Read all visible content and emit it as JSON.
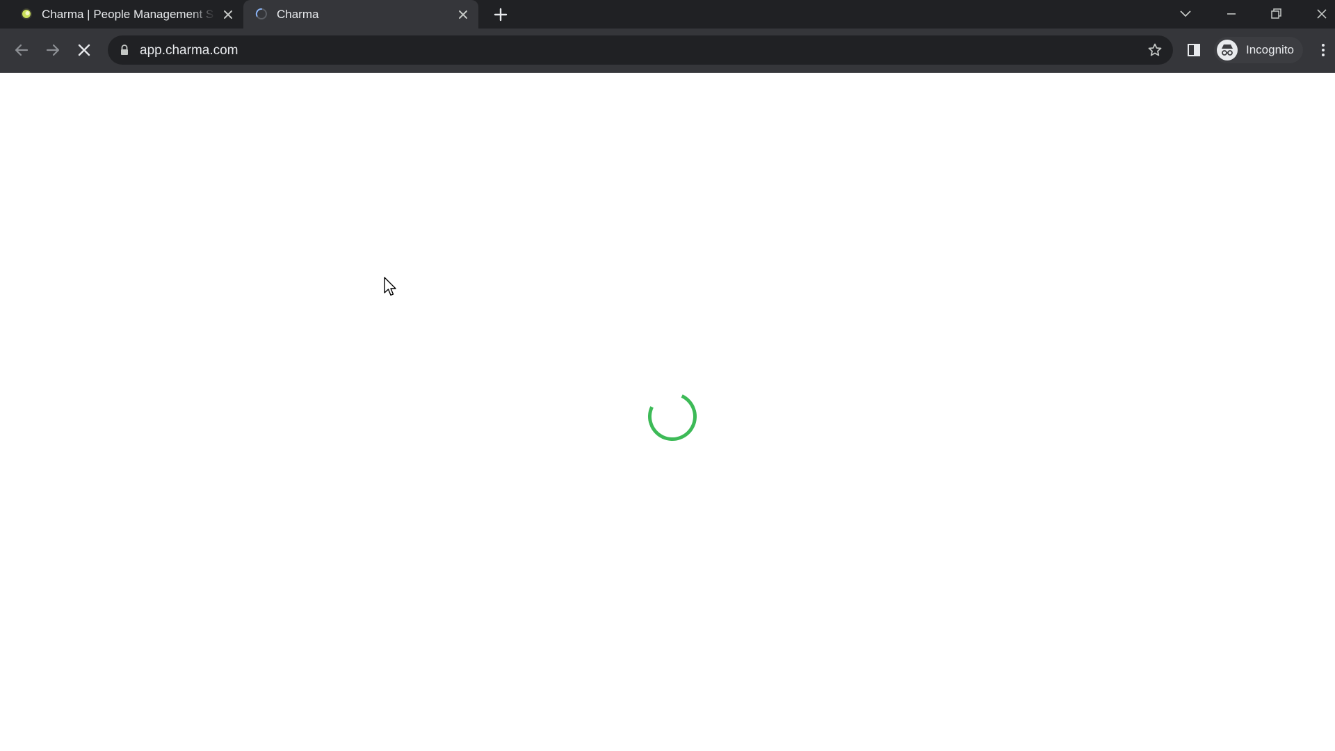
{
  "browser": {
    "tabs": [
      {
        "title": "Charma | People Management S",
        "favicon": "charma-logo-icon",
        "active": false
      },
      {
        "title": "Charma",
        "favicon": "loading-icon",
        "active": true
      }
    ],
    "address": "app.charma.com",
    "profile_label": "Incognito",
    "icons": {
      "back": "arrow-left-icon",
      "forward": "arrow-right-icon",
      "stop": "close-icon",
      "lock": "lock-icon",
      "bookmark": "star-icon",
      "side_panel": "side-panel-icon",
      "menu": "kebab-menu-icon",
      "new_tab": "plus-icon",
      "tab_search": "chevron-down-icon",
      "minimize": "minimize-icon",
      "restore": "restore-icon",
      "close_window": "close-icon"
    }
  },
  "page": {
    "state": "loading",
    "spinner_color": "#3dba57"
  },
  "colors": {
    "tabstrip_bg": "#202124",
    "toolbar_bg": "#35363a",
    "omnibox_bg": "#202124",
    "text": "#e8eaed",
    "page_bg": "#ffffff"
  }
}
